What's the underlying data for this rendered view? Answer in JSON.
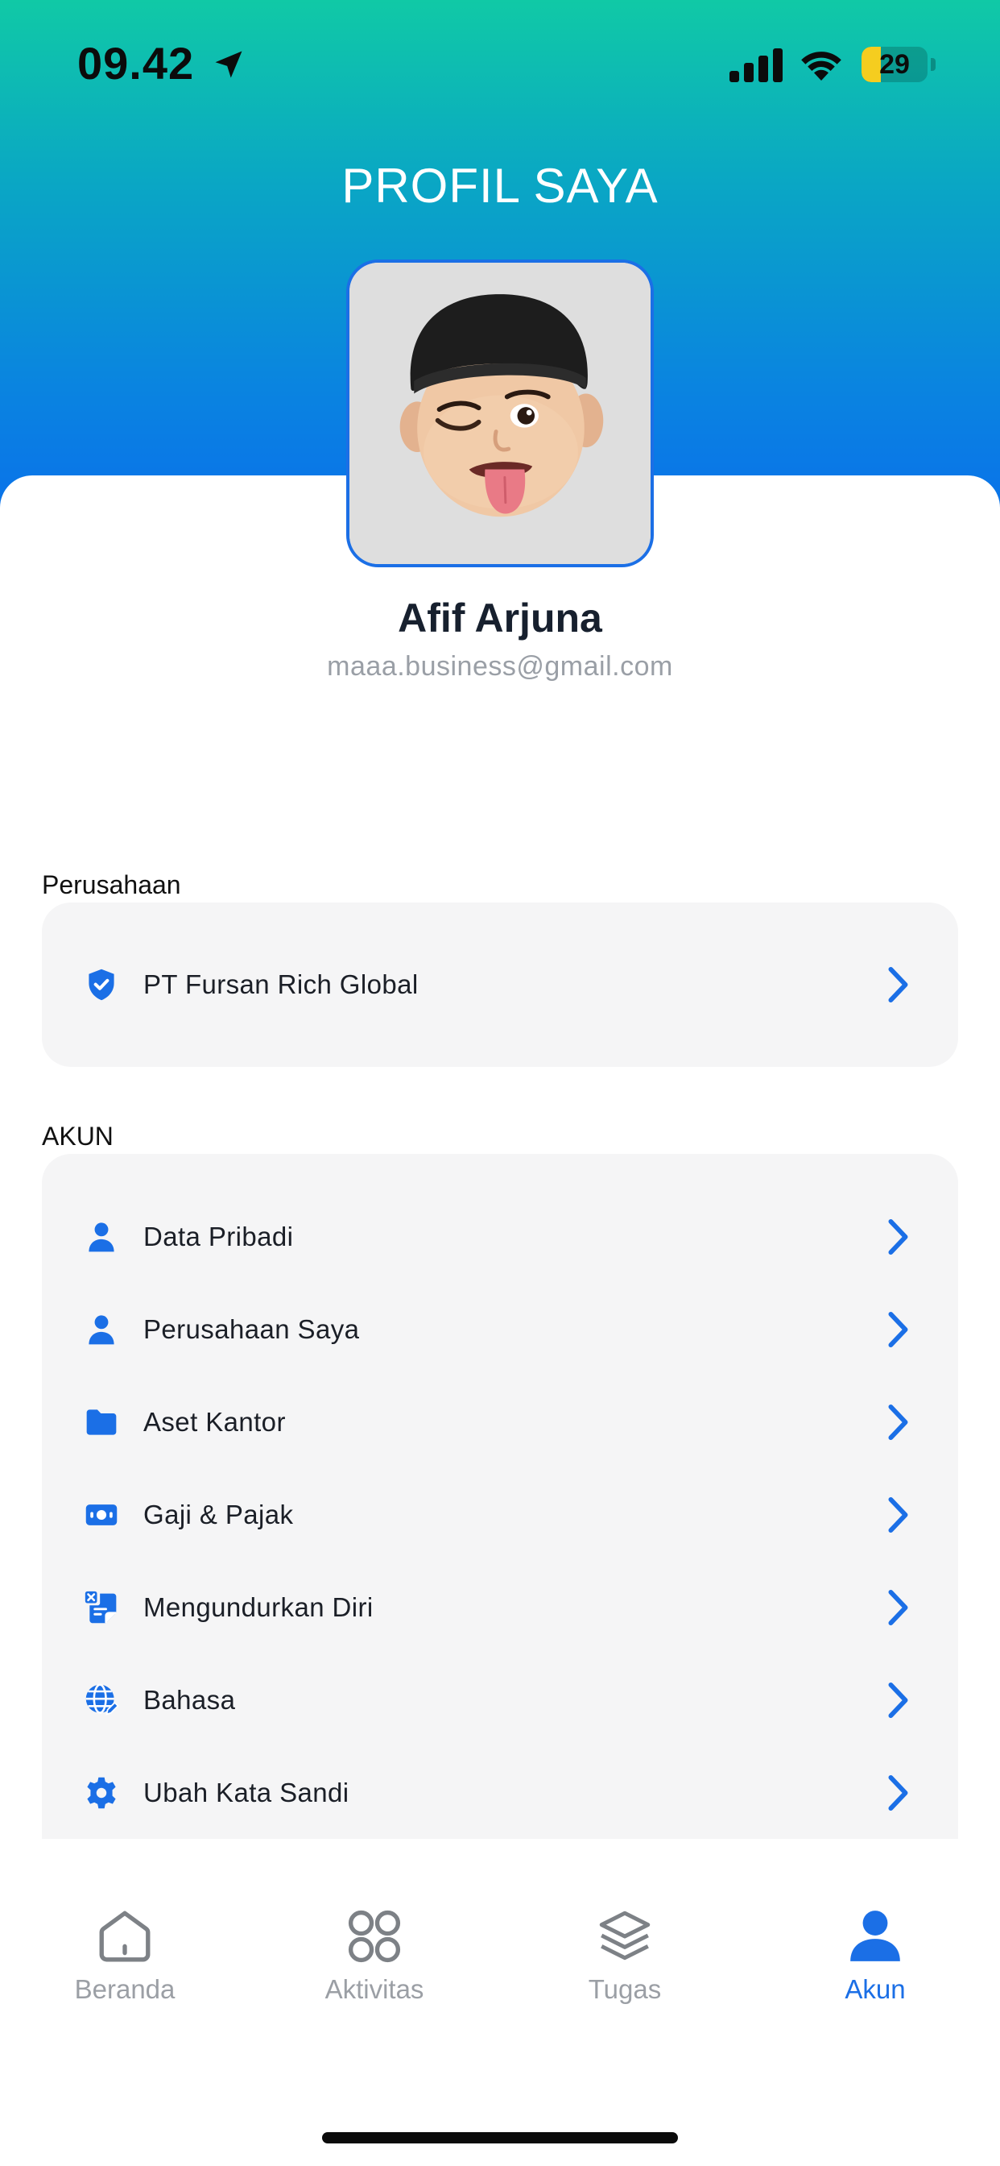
{
  "status_bar": {
    "time": "09.42",
    "battery": "29",
    "battery_level": 0.29
  },
  "header": {
    "title": "PROFIL SAYA"
  },
  "profile": {
    "name": "Afif Arjuna",
    "email": "maaa.business@gmail.com"
  },
  "company_section": {
    "label": "Perusahaan",
    "items": [
      {
        "label": "PT Fursan Rich Global",
        "icon": "shield-check-icon"
      }
    ]
  },
  "account_section": {
    "label": "AKUN",
    "items": [
      {
        "label": "Data Pribadi",
        "icon": "person-icon"
      },
      {
        "label": "Perusahaan Saya",
        "icon": "person-icon"
      },
      {
        "label": "Aset Kantor",
        "icon": "folder-icon"
      },
      {
        "label": "Gaji & Pajak",
        "icon": "money-icon"
      },
      {
        "label": "Mengundurkan Diri",
        "icon": "resign-document-icon"
      },
      {
        "label": "Bahasa",
        "icon": "globe-icon"
      },
      {
        "label": "Ubah Kata Sandi",
        "icon": "gear-icon"
      }
    ]
  },
  "bottom_nav": {
    "items": [
      {
        "label": "Beranda",
        "icon": "home-icon",
        "active": false
      },
      {
        "label": "Aktivitas",
        "icon": "grid-icon",
        "active": false
      },
      {
        "label": "Tugas",
        "icon": "layers-icon",
        "active": false
      },
      {
        "label": "Akun",
        "icon": "person-icon",
        "active": true
      }
    ]
  },
  "colors": {
    "accent": "#1b6fe6",
    "gradient_top": "#10c9a6",
    "gradient_bottom": "#0a72ea",
    "card_bg": "#f5f5f6"
  }
}
